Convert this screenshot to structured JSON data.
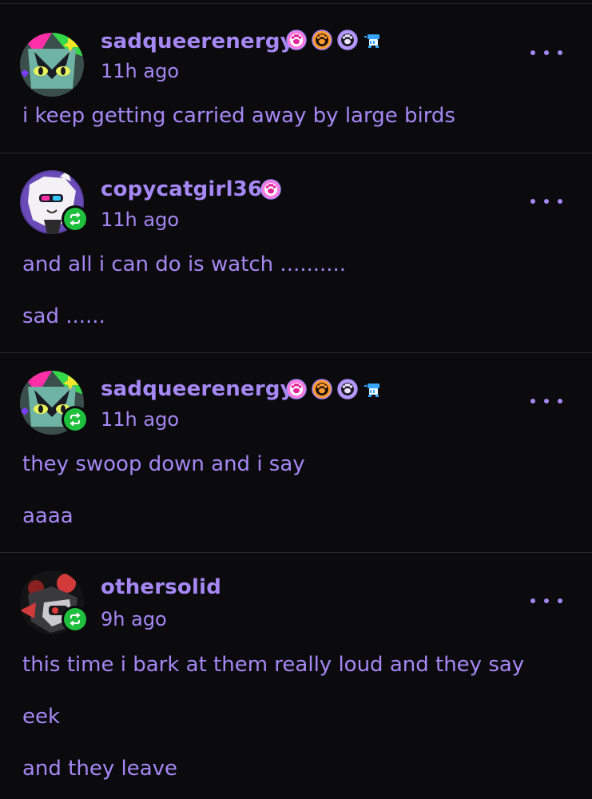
{
  "posts": [
    {
      "username": "sadqueerenergy",
      "time": "11h ago",
      "reblog": false,
      "badges": [
        "pink-paw-badge",
        "orange-paw-badge",
        "lavender-paw-badge",
        "blue-toy-badge"
      ],
      "lines": [
        "i keep getting carried away by large birds"
      ]
    },
    {
      "username": "copycatgirl36",
      "time": "11h ago",
      "reblog": true,
      "badges": [
        "pink-paw-badge"
      ],
      "lines": [
        "and all i can do is watch ..........",
        "sad ......"
      ]
    },
    {
      "username": "sadqueerenergy",
      "time": "11h ago",
      "reblog": true,
      "badges": [
        "pink-paw-badge",
        "orange-paw-badge",
        "lavender-paw-badge",
        "blue-toy-badge"
      ],
      "lines": [
        "they swoop down and i say",
        "aaaa"
      ]
    },
    {
      "username": "othersolid",
      "time": "9h ago",
      "reblog": true,
      "badges": [],
      "lines": [
        "this time i bark at them really loud and they say",
        "eek",
        "and they leave"
      ]
    }
  ],
  "colors": {
    "background": "#0b0a0d",
    "text": "#a688f5",
    "reblog_green": "#1fc03e",
    "divider": "#2a2730"
  }
}
